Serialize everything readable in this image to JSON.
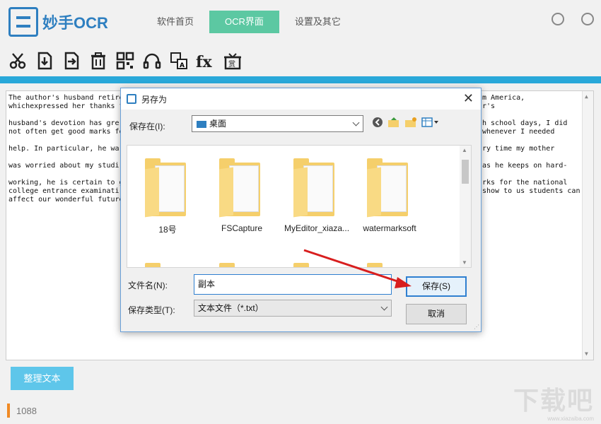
{
  "app": {
    "logo_text": "妙手OCR",
    "tabs": [
      {
        "label": "软件首页",
        "active": false
      },
      {
        "label": "OCR界面",
        "active": true
      },
      {
        "label": "设置及其它",
        "active": false
      }
    ],
    "tab_active_color": "#5cc8a2",
    "toolbar_icons": [
      "scissors-icon",
      "import-icon",
      "export-icon",
      "trash-icon",
      "qrcode-icon",
      "headset-icon",
      "translate-icon",
      "formula-icon",
      "gift-icon"
    ],
    "tool_fx_label": "fx",
    "tool_gift_label": "赏",
    "text_lines": [
      "The author's husband retire",
      "whichexpressed her thanks f",
      "husband's devotion has gre",
      "not often get good marks fo",
      "help. In particular, he wa",
      "was worried about my studi",
      "working, he is certain to g",
      "college entrance examinati",
      "affect our wonderful future"
    ],
    "text_lines_right": [
      "m America,",
      "r's",
      "h school days, I did",
      "whenever I needed",
      "ry time my mother",
      "as he keeps on hard-",
      "rks for the national",
      "show to us students can",
      ""
    ],
    "tidy_button": "整理文本",
    "status_count": "1088",
    "accent_color": "#29a8d9",
    "watermark": "下载吧",
    "watermark_sub": "www.xiazaiba.com"
  },
  "dialog": {
    "title": "另存为",
    "save_in_label": "保存在(I):",
    "save_in_value": "桌面",
    "folders": [
      {
        "name": "18号"
      },
      {
        "name": "FSCapture"
      },
      {
        "name": "MyEditor_xiaza..."
      },
      {
        "name": "watermarksoft"
      }
    ],
    "filename_label": "文件名(N):",
    "filename_value": "副本",
    "filetype_label": "保存类型(T):",
    "filetype_value": "文本文件（*.txt）",
    "save_button": "保存(S)",
    "cancel_button": "取消"
  }
}
